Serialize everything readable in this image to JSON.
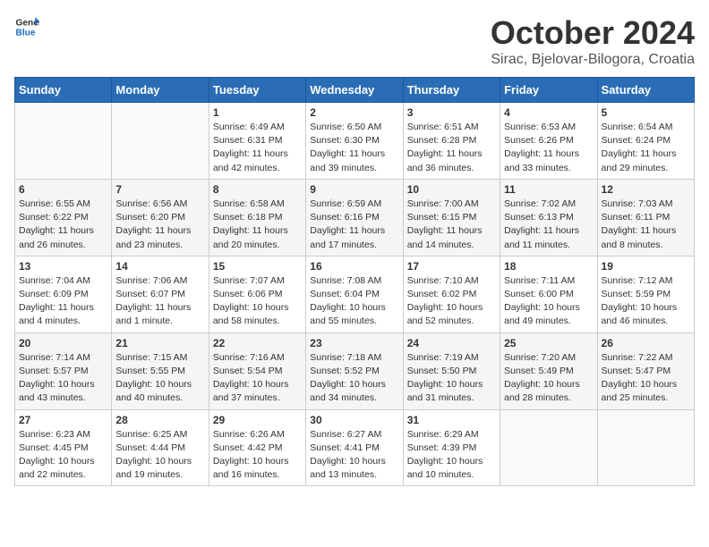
{
  "header": {
    "logo_general": "General",
    "logo_blue": "Blue",
    "month": "October 2024",
    "location": "Sirac, Bjelovar-Bilogora, Croatia"
  },
  "days_of_week": [
    "Sunday",
    "Monday",
    "Tuesday",
    "Wednesday",
    "Thursday",
    "Friday",
    "Saturday"
  ],
  "weeks": [
    [
      {
        "day": "",
        "sunrise": "",
        "sunset": "",
        "daylight": ""
      },
      {
        "day": "",
        "sunrise": "",
        "sunset": "",
        "daylight": ""
      },
      {
        "day": "1",
        "sunrise": "Sunrise: 6:49 AM",
        "sunset": "Sunset: 6:31 PM",
        "daylight": "Daylight: 11 hours and 42 minutes."
      },
      {
        "day": "2",
        "sunrise": "Sunrise: 6:50 AM",
        "sunset": "Sunset: 6:30 PM",
        "daylight": "Daylight: 11 hours and 39 minutes."
      },
      {
        "day": "3",
        "sunrise": "Sunrise: 6:51 AM",
        "sunset": "Sunset: 6:28 PM",
        "daylight": "Daylight: 11 hours and 36 minutes."
      },
      {
        "day": "4",
        "sunrise": "Sunrise: 6:53 AM",
        "sunset": "Sunset: 6:26 PM",
        "daylight": "Daylight: 11 hours and 33 minutes."
      },
      {
        "day": "5",
        "sunrise": "Sunrise: 6:54 AM",
        "sunset": "Sunset: 6:24 PM",
        "daylight": "Daylight: 11 hours and 29 minutes."
      }
    ],
    [
      {
        "day": "6",
        "sunrise": "Sunrise: 6:55 AM",
        "sunset": "Sunset: 6:22 PM",
        "daylight": "Daylight: 11 hours and 26 minutes."
      },
      {
        "day": "7",
        "sunrise": "Sunrise: 6:56 AM",
        "sunset": "Sunset: 6:20 PM",
        "daylight": "Daylight: 11 hours and 23 minutes."
      },
      {
        "day": "8",
        "sunrise": "Sunrise: 6:58 AM",
        "sunset": "Sunset: 6:18 PM",
        "daylight": "Daylight: 11 hours and 20 minutes."
      },
      {
        "day": "9",
        "sunrise": "Sunrise: 6:59 AM",
        "sunset": "Sunset: 6:16 PM",
        "daylight": "Daylight: 11 hours and 17 minutes."
      },
      {
        "day": "10",
        "sunrise": "Sunrise: 7:00 AM",
        "sunset": "Sunset: 6:15 PM",
        "daylight": "Daylight: 11 hours and 14 minutes."
      },
      {
        "day": "11",
        "sunrise": "Sunrise: 7:02 AM",
        "sunset": "Sunset: 6:13 PM",
        "daylight": "Daylight: 11 hours and 11 minutes."
      },
      {
        "day": "12",
        "sunrise": "Sunrise: 7:03 AM",
        "sunset": "Sunset: 6:11 PM",
        "daylight": "Daylight: 11 hours and 8 minutes."
      }
    ],
    [
      {
        "day": "13",
        "sunrise": "Sunrise: 7:04 AM",
        "sunset": "Sunset: 6:09 PM",
        "daylight": "Daylight: 11 hours and 4 minutes."
      },
      {
        "day": "14",
        "sunrise": "Sunrise: 7:06 AM",
        "sunset": "Sunset: 6:07 PM",
        "daylight": "Daylight: 11 hours and 1 minute."
      },
      {
        "day": "15",
        "sunrise": "Sunrise: 7:07 AM",
        "sunset": "Sunset: 6:06 PM",
        "daylight": "Daylight: 10 hours and 58 minutes."
      },
      {
        "day": "16",
        "sunrise": "Sunrise: 7:08 AM",
        "sunset": "Sunset: 6:04 PM",
        "daylight": "Daylight: 10 hours and 55 minutes."
      },
      {
        "day": "17",
        "sunrise": "Sunrise: 7:10 AM",
        "sunset": "Sunset: 6:02 PM",
        "daylight": "Daylight: 10 hours and 52 minutes."
      },
      {
        "day": "18",
        "sunrise": "Sunrise: 7:11 AM",
        "sunset": "Sunset: 6:00 PM",
        "daylight": "Daylight: 10 hours and 49 minutes."
      },
      {
        "day": "19",
        "sunrise": "Sunrise: 7:12 AM",
        "sunset": "Sunset: 5:59 PM",
        "daylight": "Daylight: 10 hours and 46 minutes."
      }
    ],
    [
      {
        "day": "20",
        "sunrise": "Sunrise: 7:14 AM",
        "sunset": "Sunset: 5:57 PM",
        "daylight": "Daylight: 10 hours and 43 minutes."
      },
      {
        "day": "21",
        "sunrise": "Sunrise: 7:15 AM",
        "sunset": "Sunset: 5:55 PM",
        "daylight": "Daylight: 10 hours and 40 minutes."
      },
      {
        "day": "22",
        "sunrise": "Sunrise: 7:16 AM",
        "sunset": "Sunset: 5:54 PM",
        "daylight": "Daylight: 10 hours and 37 minutes."
      },
      {
        "day": "23",
        "sunrise": "Sunrise: 7:18 AM",
        "sunset": "Sunset: 5:52 PM",
        "daylight": "Daylight: 10 hours and 34 minutes."
      },
      {
        "day": "24",
        "sunrise": "Sunrise: 7:19 AM",
        "sunset": "Sunset: 5:50 PM",
        "daylight": "Daylight: 10 hours and 31 minutes."
      },
      {
        "day": "25",
        "sunrise": "Sunrise: 7:20 AM",
        "sunset": "Sunset: 5:49 PM",
        "daylight": "Daylight: 10 hours and 28 minutes."
      },
      {
        "day": "26",
        "sunrise": "Sunrise: 7:22 AM",
        "sunset": "Sunset: 5:47 PM",
        "daylight": "Daylight: 10 hours and 25 minutes."
      }
    ],
    [
      {
        "day": "27",
        "sunrise": "Sunrise: 6:23 AM",
        "sunset": "Sunset: 4:45 PM",
        "daylight": "Daylight: 10 hours and 22 minutes."
      },
      {
        "day": "28",
        "sunrise": "Sunrise: 6:25 AM",
        "sunset": "Sunset: 4:44 PM",
        "daylight": "Daylight: 10 hours and 19 minutes."
      },
      {
        "day": "29",
        "sunrise": "Sunrise: 6:26 AM",
        "sunset": "Sunset: 4:42 PM",
        "daylight": "Daylight: 10 hours and 16 minutes."
      },
      {
        "day": "30",
        "sunrise": "Sunrise: 6:27 AM",
        "sunset": "Sunset: 4:41 PM",
        "daylight": "Daylight: 10 hours and 13 minutes."
      },
      {
        "day": "31",
        "sunrise": "Sunrise: 6:29 AM",
        "sunset": "Sunset: 4:39 PM",
        "daylight": "Daylight: 10 hours and 10 minutes."
      },
      {
        "day": "",
        "sunrise": "",
        "sunset": "",
        "daylight": ""
      },
      {
        "day": "",
        "sunrise": "",
        "sunset": "",
        "daylight": ""
      }
    ]
  ]
}
